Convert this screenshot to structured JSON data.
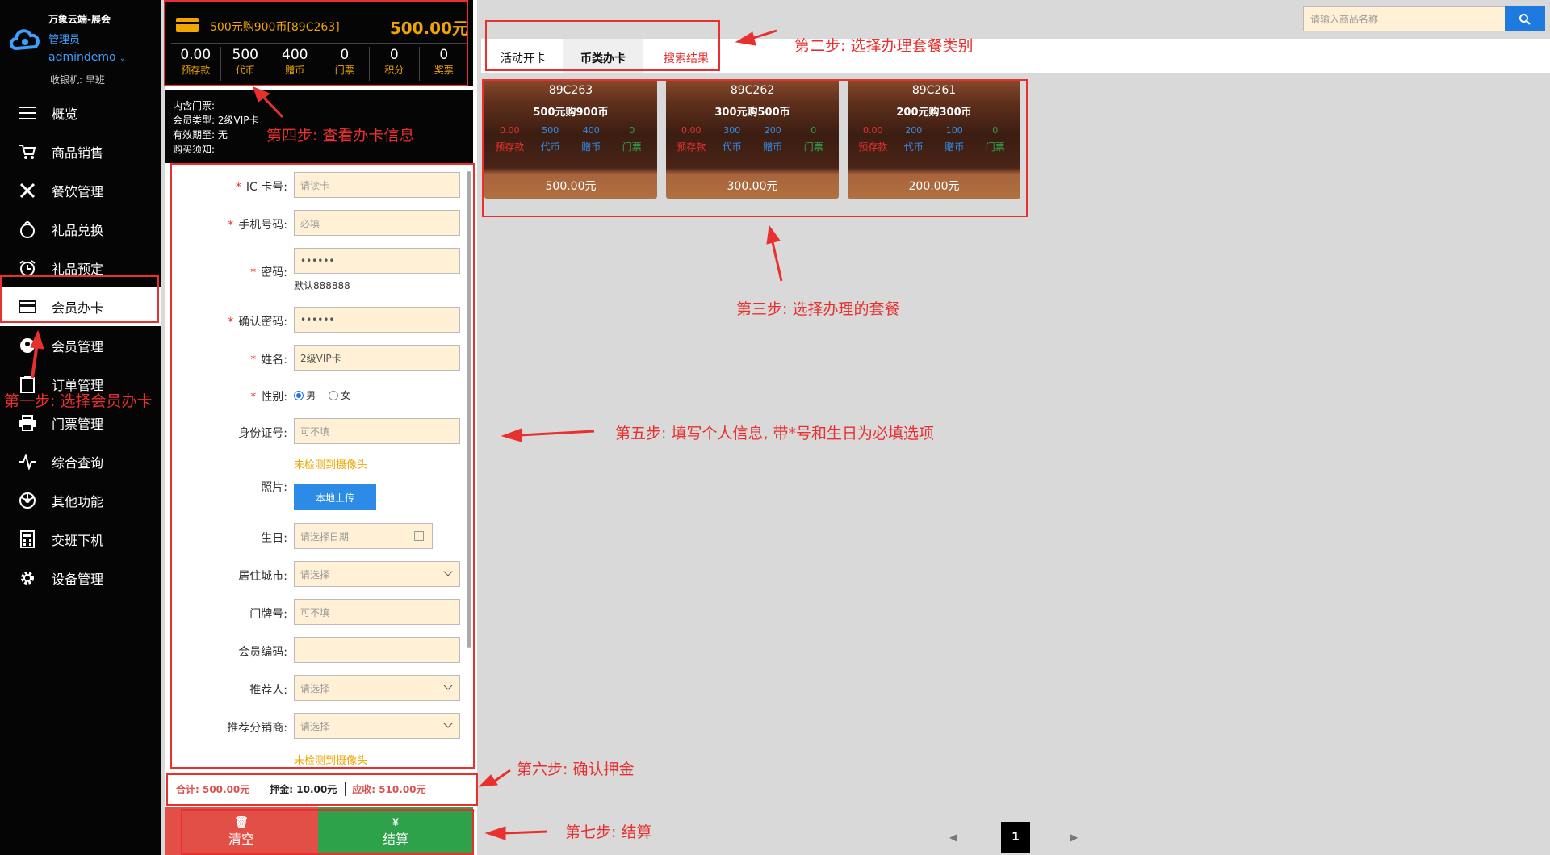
{
  "sidebar": {
    "company": "万象云端-展会",
    "role": "管理员",
    "user": "admindemo",
    "shift": "收银机: 早班",
    "items": [
      {
        "label": "概览",
        "icon": "menu-lines-icon"
      },
      {
        "label": "商品销售",
        "icon": "cart-icon"
      },
      {
        "label": "餐饮管理",
        "icon": "fork-knife-icon"
      },
      {
        "label": "礼品兑换",
        "icon": "gift-bag-icon"
      },
      {
        "label": "礼品预定",
        "icon": "alarm-clock-icon"
      },
      {
        "label": "会员办卡",
        "icon": "card-icon",
        "active": true
      },
      {
        "label": "会员管理",
        "icon": "member-icon"
      },
      {
        "label": "订单管理",
        "icon": "clipboard-icon"
      },
      {
        "label": "门票管理",
        "icon": "printer-icon"
      },
      {
        "label": "综合查询",
        "icon": "pulse-icon"
      },
      {
        "label": "其他功能",
        "icon": "aperture-icon"
      },
      {
        "label": "交班下机",
        "icon": "calculator-icon"
      },
      {
        "label": "设备管理",
        "icon": "gear-icon"
      }
    ]
  },
  "card": {
    "name": "500元购900币[89C263]",
    "price": "500.00元",
    "stats": [
      {
        "value": "0.00",
        "label": "预存款"
      },
      {
        "value": "500",
        "label": "代币"
      },
      {
        "value": "400",
        "label": "赠币"
      },
      {
        "value": "0",
        "label": "门票"
      },
      {
        "value": "0",
        "label": "积分"
      },
      {
        "value": "0",
        "label": "奖票"
      }
    ],
    "info": {
      "tickets": "内含门票:",
      "type": "会员类型: 2级VIP卡",
      "expiry": "有效期至: 无",
      "notice": "购买须知:"
    }
  },
  "form": {
    "ic_label": "IC 卡号:",
    "ic_placeholder": "请读卡",
    "phone_label": "手机号码:",
    "phone_placeholder": "必填",
    "pwd_label": "密码:",
    "pwd_value": "••••••",
    "pwd_hint": "默认888888",
    "pwd2_label": "确认密码:",
    "pwd2_value": "••••••",
    "name_label": "姓名:",
    "name_value": "2级VIP卡",
    "gender_label": "性别:",
    "gender_male": "男",
    "gender_female": "女",
    "id_label": "身份证号:",
    "id_placeholder": "可不填",
    "camera_warning": "未检测到摄像头",
    "photo_label": "照片:",
    "upload_label": "本地上传",
    "birthday_label": "生日:",
    "birthday_placeholder": "请选择日期",
    "city_label": "居住城市:",
    "city_placeholder": "请选择",
    "door_label": "门牌号:",
    "door_placeholder": "可不填",
    "code_label": "会员编码:",
    "referrer_label": "推荐人:",
    "referrer_placeholder": "请选择",
    "distributor_label": "推荐分销商:",
    "distributor_placeholder": "请选择",
    "camera_warning2": "未检测到摄像头"
  },
  "totals": {
    "sum": "合计: 500.00元",
    "deposit": "押金: 10.00元",
    "due": "应收: 510.00元"
  },
  "actions": {
    "clear_symbol": "🗑",
    "clear": "清空",
    "pay_symbol": "¥",
    "pay": "结算"
  },
  "search": {
    "placeholder": "请输入商品名称"
  },
  "tabs": [
    "活动开卡",
    "币类办卡",
    "搜索结果"
  ],
  "packages": [
    {
      "code": "89C263",
      "name": "500元购900币",
      "prepay": "0.00",
      "token": "500",
      "gift": "400",
      "ticket": "0",
      "price": "500.00元"
    },
    {
      "code": "89C262",
      "name": "300元购500币",
      "prepay": "0.00",
      "token": "300",
      "gift": "200",
      "ticket": "0",
      "price": "300.00元"
    },
    {
      "code": "89C261",
      "name": "200元购300币",
      "prepay": "0.00",
      "token": "200",
      "gift": "100",
      "ticket": "0",
      "price": "200.00元"
    }
  ],
  "package_labels": {
    "prepay": "预存款",
    "token": "代币",
    "gift": "赠币",
    "ticket": "门票"
  },
  "pager": {
    "prev": "◀",
    "current": "1",
    "next": "▶"
  },
  "annotations": {
    "step1": "第一步: 选择会员办卡",
    "step2": "第二步: 选择办理套餐类别",
    "step3": "第三步: 选择办理的套餐",
    "step4": "第四步: 查看办卡信息",
    "step5": "第五步: 填写个人信息, 带*号和生日为必填选项",
    "step6": "第六步: 确认押金",
    "step7": "第七步: 结算"
  },
  "colors": {
    "accent": "#f0a500",
    "annotation": "#e8312f",
    "primary": "#1f7ae0",
    "pay": "#2ea24a",
    "clear": "#e24f46"
  }
}
